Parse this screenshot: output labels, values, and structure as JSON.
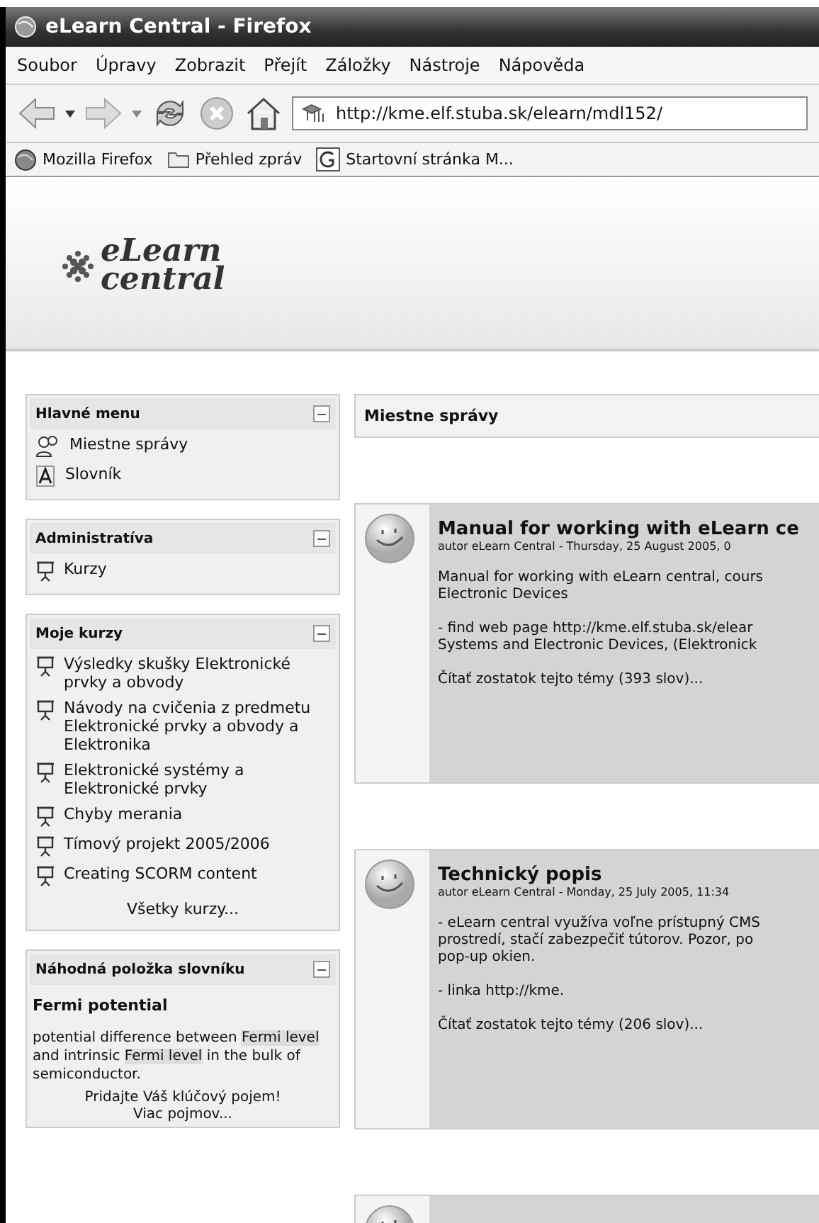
{
  "window": {
    "title": "eLearn Central - Firefox"
  },
  "menu": [
    {
      "label": "Soubor"
    },
    {
      "label": "Úpravy"
    },
    {
      "label": "Zobrazit"
    },
    {
      "label": "Přejít"
    },
    {
      "label": "Záložky"
    },
    {
      "label": "Nástroje"
    },
    {
      "label": "Nápověda"
    }
  ],
  "address": {
    "value": "http://kme.elf.stuba.sk/elearn/mdl152/"
  },
  "bookmarks": [
    {
      "kind": "firefox",
      "label": "Mozilla Firefox"
    },
    {
      "kind": "folder",
      "label": "Přehled zpráv"
    },
    {
      "kind": "google",
      "label": "Startovní stránka M..."
    }
  ],
  "logo": {
    "line_1": "eLearn",
    "line_2": "central"
  },
  "sidebar": [
    {
      "title": "Hlavné menu",
      "items": [
        {
          "kind": "people",
          "label": "Miestne správy"
        },
        {
          "kind": "glossary",
          "label": "Slovník"
        }
      ]
    },
    {
      "title": "Administratíva",
      "items": [
        {
          "kind": "course",
          "label": "Kurzy"
        }
      ]
    },
    {
      "title": "Moje kurzy",
      "items": [
        {
          "kind": "course",
          "label": "Výsledky skušky Elektronické prvky a obvody"
        },
        {
          "kind": "course",
          "label": "Návody na cvičenia z predmetu Elektronické prvky a obvody a Elektronika"
        },
        {
          "kind": "course",
          "label": "Elektronické systémy a Elektronické prvky"
        },
        {
          "kind": "course",
          "label": "Chyby merania"
        },
        {
          "kind": "course",
          "label": "Tímový projekt 2005/2006"
        },
        {
          "kind": "course",
          "label": "Creating SCORM content"
        }
      ],
      "footer": "Všetky kurzy..."
    },
    {
      "title": "Náhodná položka slovníku",
      "term": "Fermi potential",
      "definition": [
        {
          "text": "potential difference between ",
          "highlighted": false
        },
        {
          "text": "Fermi level",
          "highlighted": true
        },
        {
          "text": " and intrinsic ",
          "highlighted": false
        },
        {
          "text": "Fermi level",
          "highlighted": true
        },
        {
          "text": " in the bulk of semiconductor.",
          "highlighted": false
        }
      ],
      "links": [
        "Pridajte Váš klúčový pojem!",
        "Viac pojmov..."
      ]
    }
  ],
  "main": {
    "title": "Miestne správy",
    "posts": [
      {
        "title": "Manual for working with eLearn ce",
        "byline": "autor eLearn Central - Thursday, 25 August 2005, 0",
        "paragraphs": [
          [
            "Manual for working with eLearn central, cours",
            "Electronic Devices"
          ],
          [
            "- find web page http://kme.elf.stuba.sk/elear",
            "Systems and Electronic Devices, (Elektronick"
          ]
        ],
        "more": "Čítať zostatok tejto témy (393 slov)..."
      },
      {
        "title": "Technický popis",
        "byline": "autor eLearn Central - Monday, 25 July 2005, 11:34",
        "paragraphs": [
          [
            "- eLearn central využíva voľne prístupný CMS",
            "prostredí, stačí zabezpečiť tútorov. Pozor, po",
            "pop-up okien."
          ],
          [
            "- linka http://kme."
          ]
        ],
        "more": "Čítať zostatok tejto témy (206 slov)..."
      }
    ]
  }
}
